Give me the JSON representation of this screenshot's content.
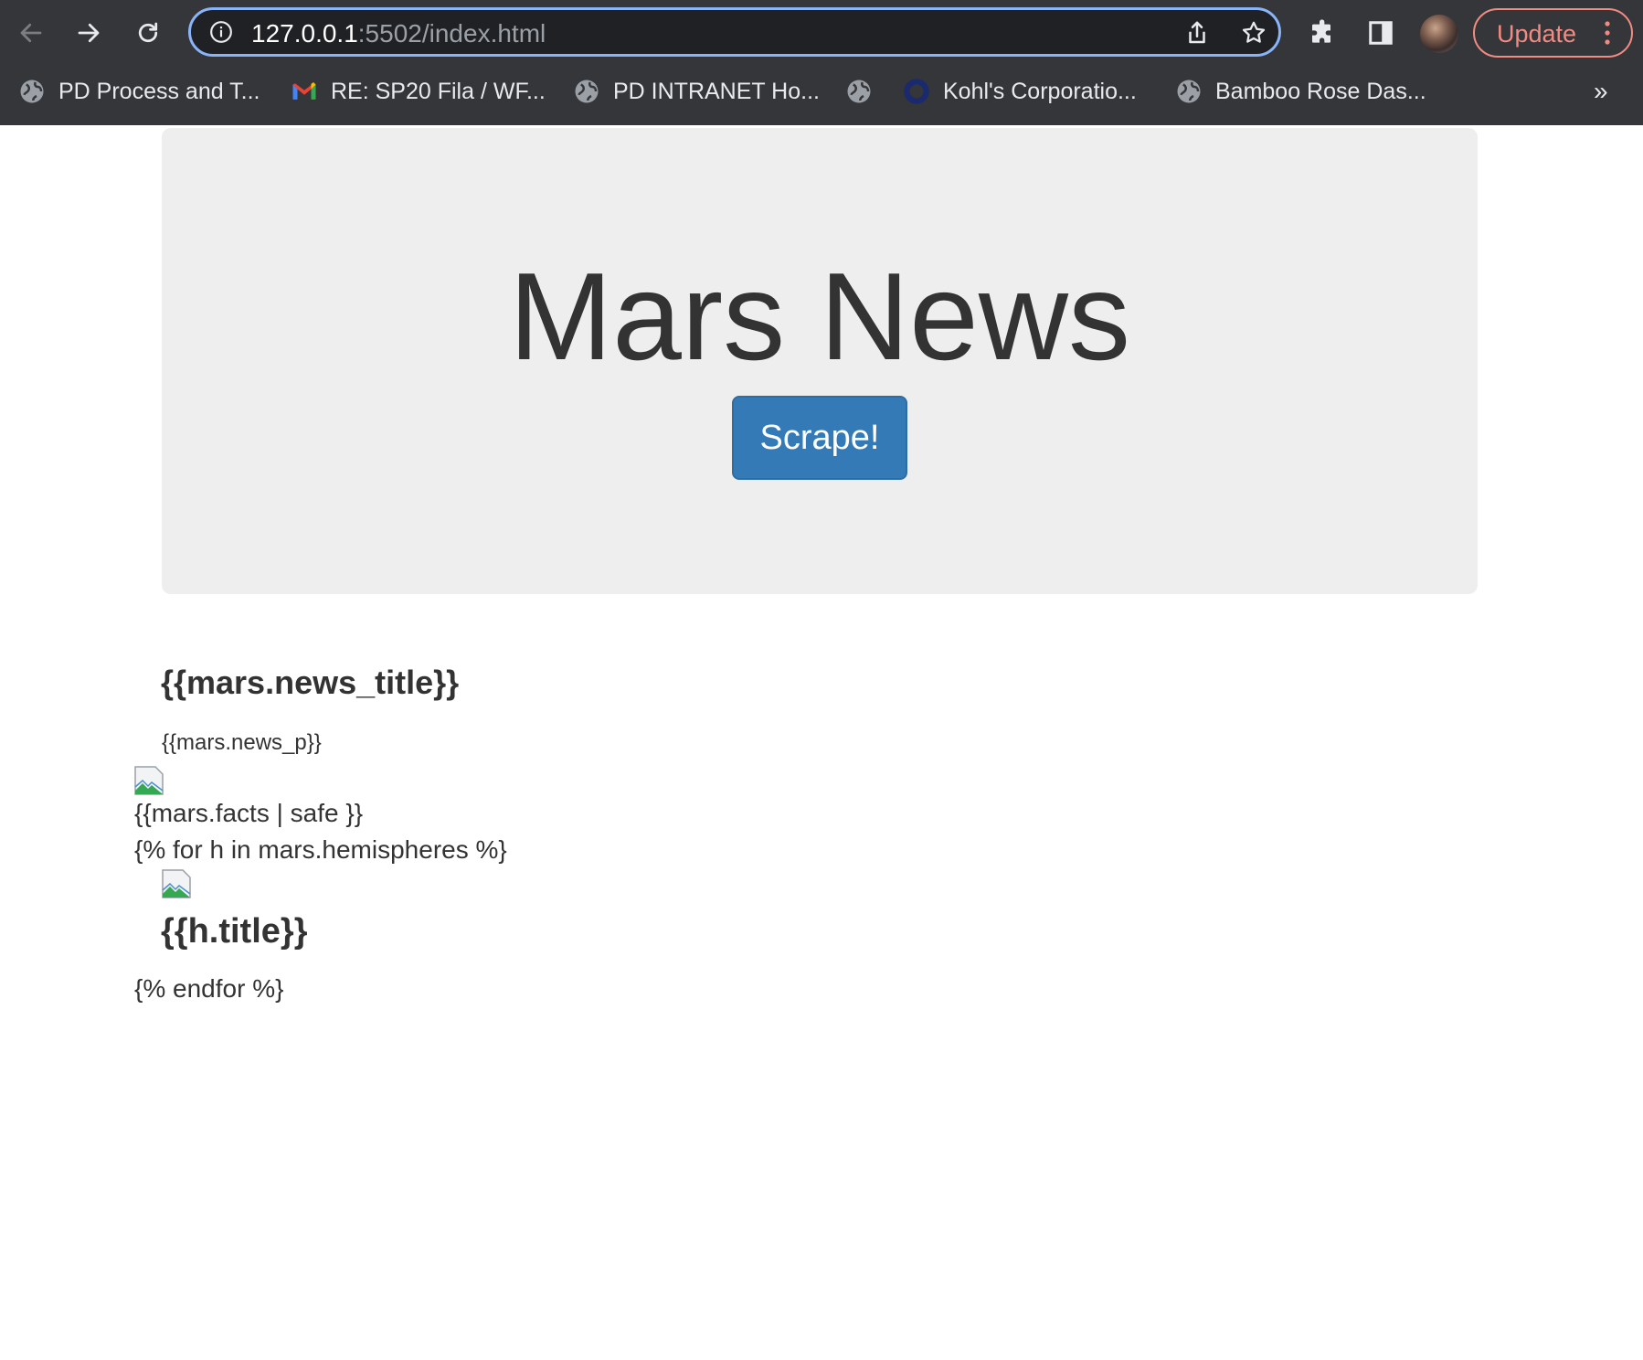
{
  "browser": {
    "url_host": "127.0.0.1",
    "url_rest": ":5502/index.html",
    "update_label": "Update",
    "bookmarks": [
      {
        "label": "PD Process and T...",
        "icon": "globe-icon"
      },
      {
        "label": "RE: SP20 Fila / WF...",
        "icon": "gmail-icon"
      },
      {
        "label": "PD INTRANET Ho...",
        "icon": "globe-icon"
      },
      {
        "label": "",
        "icon": "globe-icon"
      },
      {
        "label": "Kohl's Corporatio...",
        "icon": "kohls-ring-icon"
      },
      {
        "label": "Bamboo Rose Das...",
        "icon": "globe-icon"
      }
    ],
    "bookmarks_overflow": "»"
  },
  "page": {
    "jumbotron": {
      "title": "Mars News",
      "button_label": "Scrape!"
    },
    "news_title": "{{mars.news_title}}",
    "news_p": "{{mars.news_p}}",
    "facts": "{{mars.facts | safe }}",
    "for_open": "{% for h in mars.hemispheres %}",
    "h_title": "{{h.title}}",
    "for_close": "{% endfor %}"
  },
  "colors": {
    "chrome_bg": "#35363a",
    "omnibox_bg": "#202124",
    "focus_ring": "#8ab4f8",
    "update_accent": "#f28b82",
    "jumbotron_bg": "#eeeeee",
    "button_primary": "#337ab7",
    "text": "#333333"
  }
}
